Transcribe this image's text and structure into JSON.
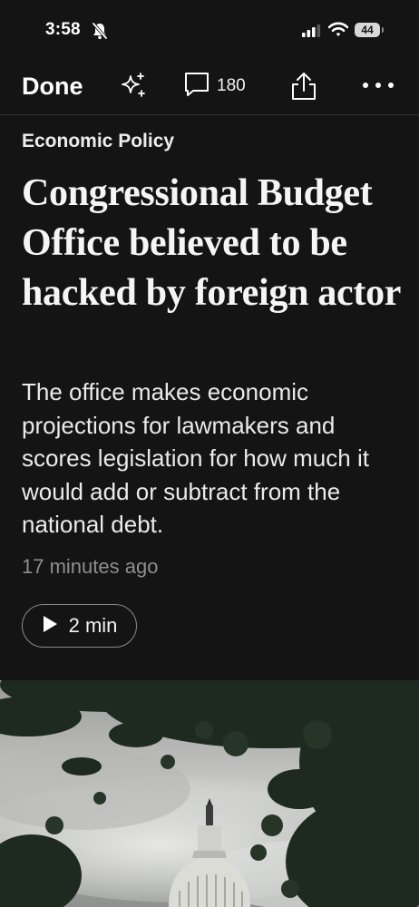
{
  "status_bar": {
    "time": "3:58",
    "battery": "44",
    "icons": [
      "bell-slash-icon",
      "cellular-signal-icon",
      "wifi-icon",
      "battery-icon"
    ]
  },
  "toolbar": {
    "done_label": "Done",
    "comment_count": "180",
    "icons": [
      "sparkle-icon",
      "comment-icon",
      "share-icon",
      "more-icon"
    ]
  },
  "article": {
    "kicker": "Economic Policy",
    "headline": "Congressional Budget Office believed to be hacked by foreign actor",
    "dek": "The office makes economic projections for lawmakers and scores legislation for how much it would add or subtract from the national debt.",
    "timestamp": "17 minutes ago",
    "listen_label": "2 min"
  },
  "colors": {
    "background": "#141414",
    "text": "#f2f2f2",
    "muted": "#8e8e8e",
    "divider": "#333333"
  }
}
